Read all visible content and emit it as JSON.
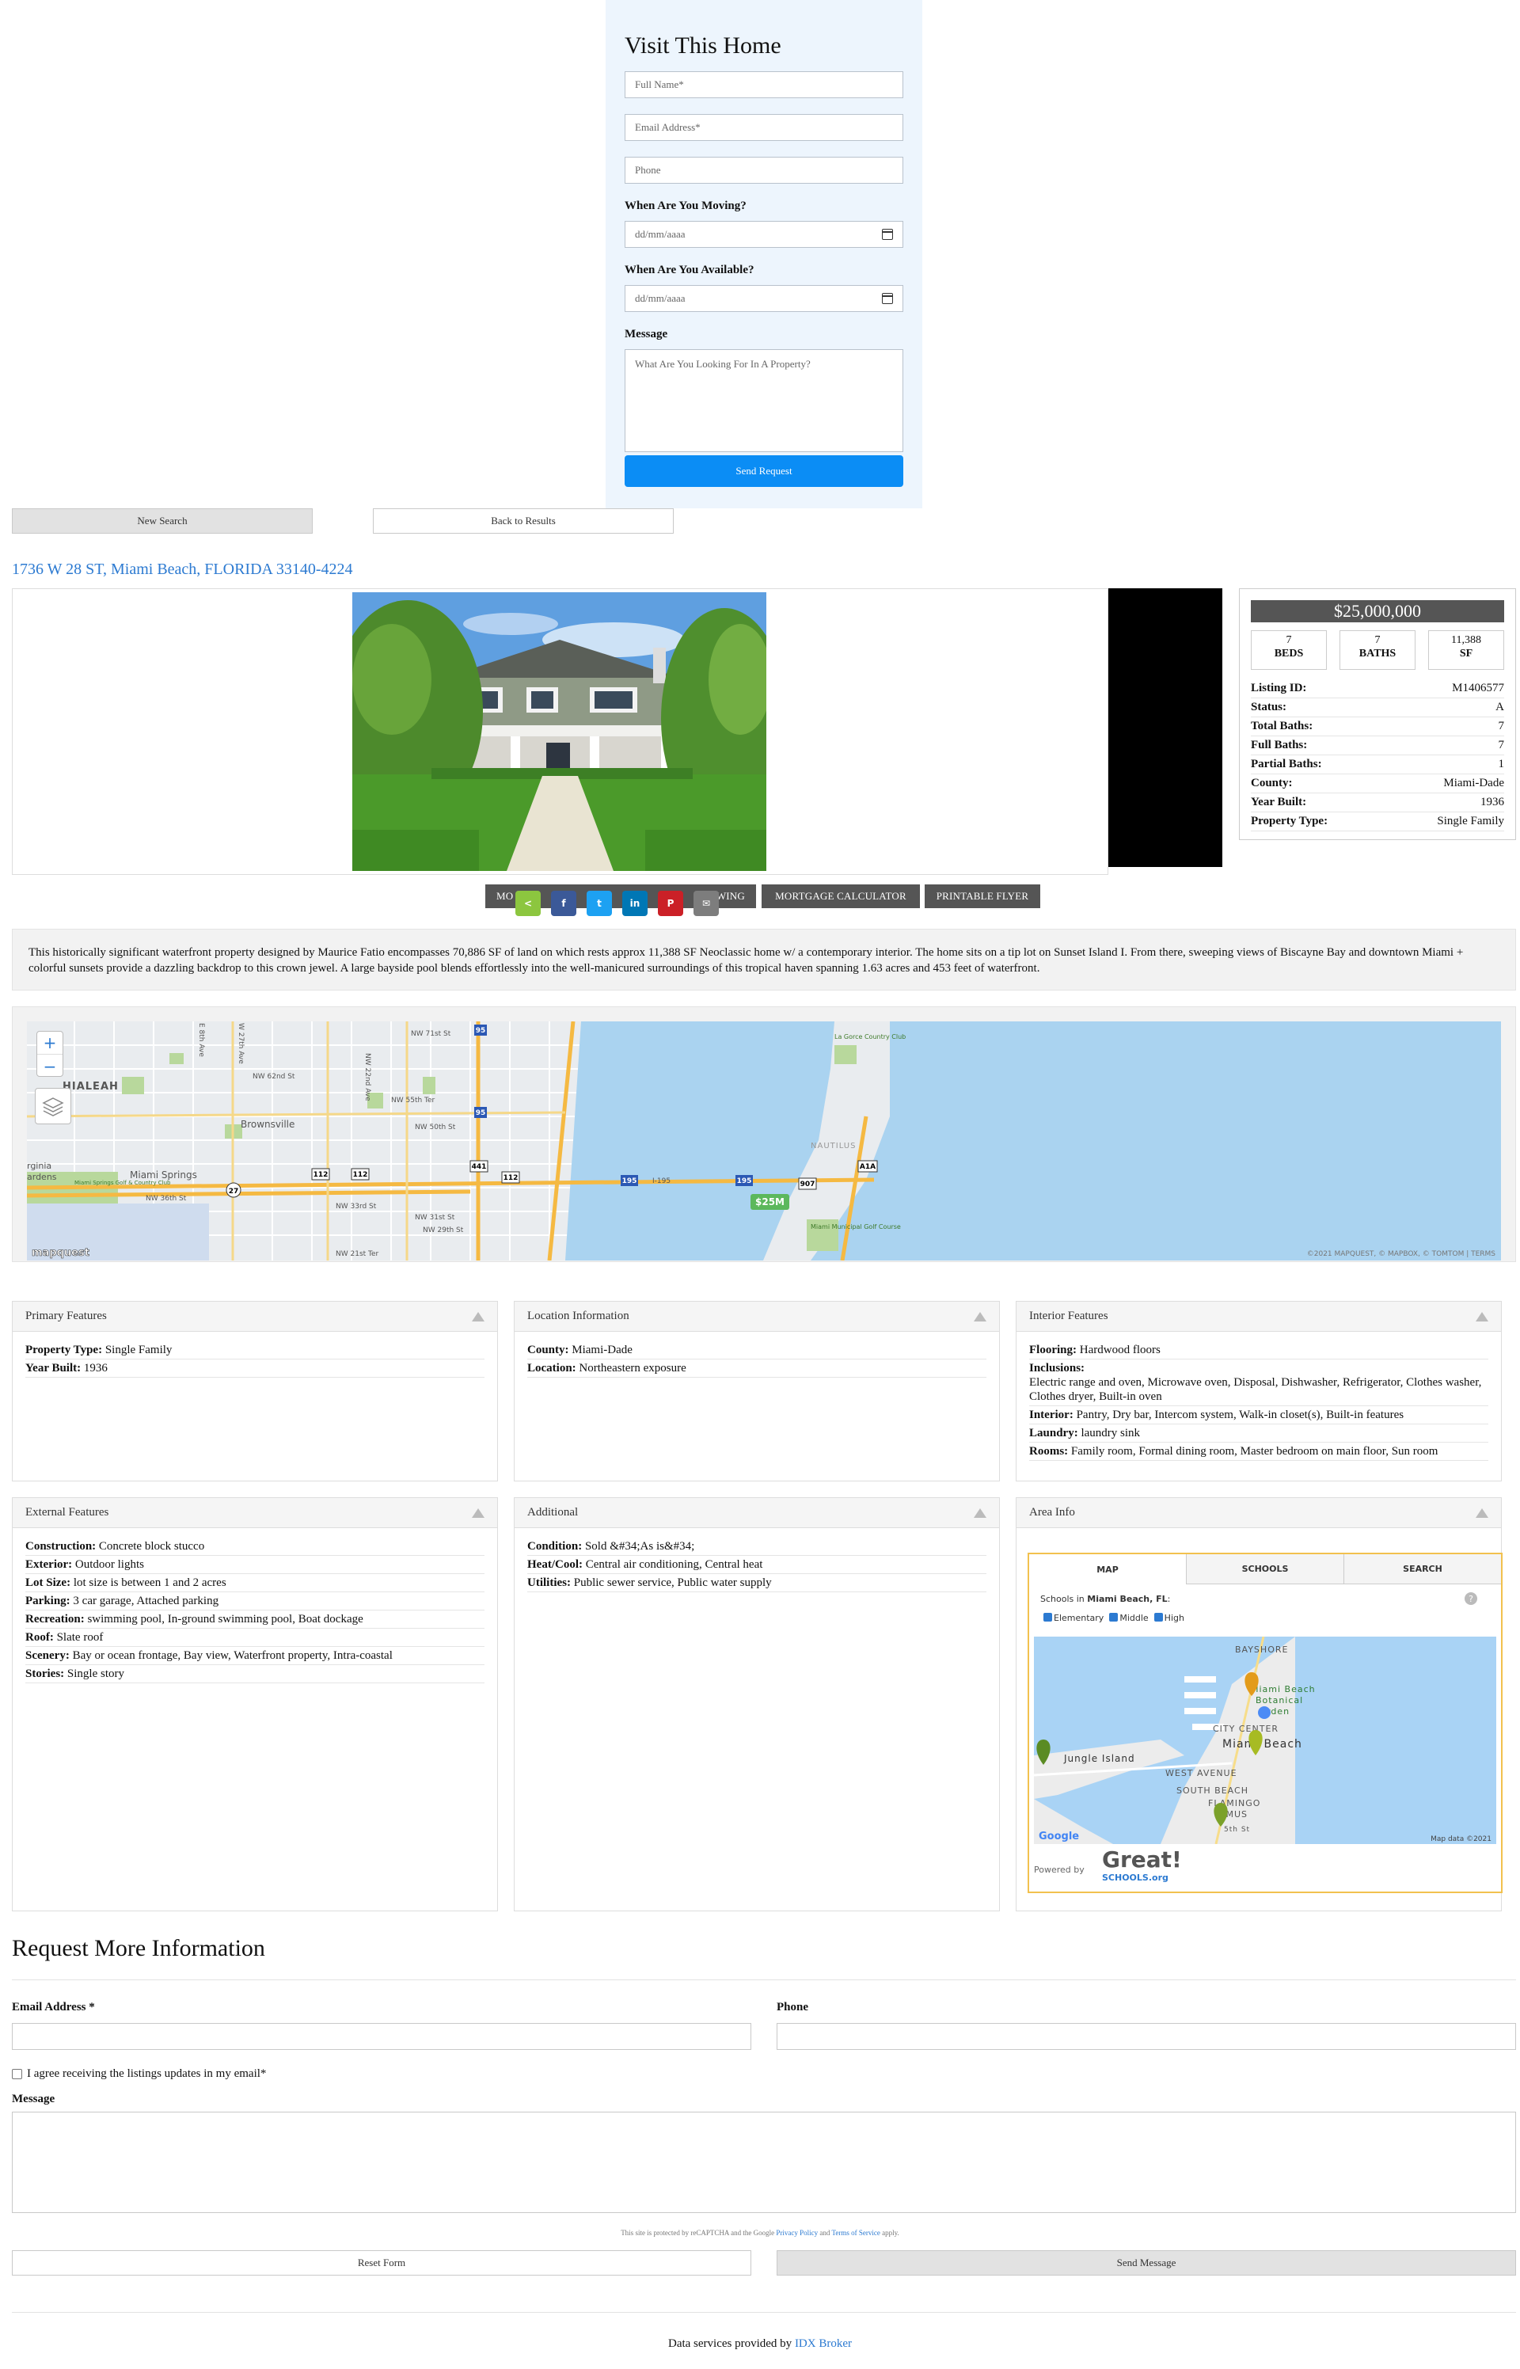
{
  "visit": {
    "title": "Visit This Home",
    "name_placeholder": "Full Name*",
    "email_placeholder": "Email Address*",
    "phone_placeholder": "Phone",
    "moving_label": "When Are You Moving?",
    "moving_date": "dd/mm/aaaa",
    "available_label": "When Are You Available?",
    "available_date": "dd/mm/aaaa",
    "message_label": "Message",
    "message_placeholder": "What Are You Looking For In A Property?",
    "send_label": "Send Request"
  },
  "nav": {
    "new_search": "New Search",
    "back": "Back to Results"
  },
  "address": "1736 W 28 ST, Miami Beach, FLORIDA 33140-4224",
  "listing": {
    "price": "$25,000,000",
    "beds": "7",
    "beds_label": "BEDS",
    "baths": "7",
    "baths_label": "BATHS",
    "sf": "11,388",
    "sf_label": "SF",
    "details": [
      {
        "k": "Listing ID:",
        "v": "M1406577"
      },
      {
        "k": "Status:",
        "v": "A"
      },
      {
        "k": "Total Baths:",
        "v": "7"
      },
      {
        "k": "Full Baths:",
        "v": "7"
      },
      {
        "k": "Partial Baths:",
        "v": "1"
      },
      {
        "k": "County:",
        "v": "Miami-Dade"
      },
      {
        "k": "Year Built:",
        "v": "1936"
      },
      {
        "k": "Property Type:",
        "v": "Single Family"
      }
    ]
  },
  "actions": {
    "schedule_a": "MO",
    "schedule_b": "WING",
    "mortgage": "MORTGAGE CALCULATOR",
    "flyer": "PRINTABLE FLYER"
  },
  "share_icons": {
    "share": "<",
    "facebook": "f",
    "twitter": "t",
    "linkedin": "in",
    "pinterest": "P",
    "email": "✉"
  },
  "description": "This historically significant waterfront property designed by Maurice Fatio encompasses 70,886 SF of land on which rests approx 11,388 SF Neoclassic home w/ a contemporary interior. The home sits on a tip lot on Sunset Island I. From there, sweeping views of Biscayne Bay and downtown Miami + colorful sunsets provide a dazzling backdrop to this crown jewel. A large bayside pool blends effortlessly into the well-manicured surroundings of this tropical haven spanning 1.63 acres and 453 feet of waterfront.",
  "map": {
    "zoom_in": "+",
    "zoom_out": "−",
    "pin_label": "$25M",
    "credit": "©2021 MAPQUEST, © MAPBOX, © TOMTOM | TERMS",
    "logo": "mapquest",
    "labels": {
      "hialeah": "HIALEAH",
      "brownsville": "Brownsville",
      "miami_springs": "Miami Springs",
      "springs_golf": "Miami Springs Golf & Country Club",
      "virginia": "rginia",
      "gardens": "ardens",
      "nw71": "NW 71st St",
      "nw62": "NW 62nd St",
      "nw55": "NW 55th Ter",
      "nw50": "NW 50th St",
      "nw36": "NW 36th St",
      "nw33": "NW 33rd St",
      "nw31": "NW 31st St",
      "nw29": "NW 29th St",
      "nw21": "NW 21st Ter",
      "e8": "E 8th Ave",
      "w27": "W 27th Ave",
      "nw22": "NW 22nd Ave",
      "i195": "I-195",
      "lagorce": "La Gorce Country Club",
      "nautilus": "NAUTILUS",
      "municipal": "Miami Municipal Golf Course",
      "r95a": "95",
      "r95b": "95",
      "r441": "441",
      "r112a": "112",
      "r112b": "112",
      "r112c": "112",
      "r27": "27",
      "r195a": "195",
      "r195b": "195",
      "r907": "907",
      "ra1a": "A1A"
    }
  },
  "panels": {
    "primary": {
      "title": "Primary Features",
      "rows": [
        {
          "k": "Property Type:",
          "v": "Single Family"
        },
        {
          "k": "Year Built:",
          "v": "1936"
        }
      ]
    },
    "location": {
      "title": "Location Information",
      "rows": [
        {
          "k": "County:",
          "v": "Miami-Dade"
        },
        {
          "k": "Location:",
          "v": "Northeastern exposure"
        }
      ]
    },
    "interior": {
      "title": "Interior Features",
      "rows": [
        {
          "k": "Flooring:",
          "v": "Hardwood floors"
        },
        {
          "k": "Inclusions:",
          "v": "Electric range and oven, Microwave oven, Disposal, Dishwasher, Refrigerator, Clothes washer, Clothes dryer, Built-in oven"
        },
        {
          "k": "Interior:",
          "v": "Pantry, Dry bar, Intercom system, Walk-in closet(s), Built-in features"
        },
        {
          "k": "Laundry:",
          "v": "laundry sink"
        },
        {
          "k": "Rooms:",
          "v": "Family room, Formal dining room, Master bedroom on main floor, Sun room"
        }
      ]
    },
    "external": {
      "title": "External Features",
      "rows": [
        {
          "k": "Construction:",
          "v": "Concrete block stucco"
        },
        {
          "k": "Exterior:",
          "v": "Outdoor lights"
        },
        {
          "k": "Lot Size:",
          "v": "lot size is between 1 and 2 acres"
        },
        {
          "k": "Parking:",
          "v": "3 car garage, Attached parking"
        },
        {
          "k": "Recreation:",
          "v": "swimming pool, In-ground swimming pool, Boat dockage"
        },
        {
          "k": "Roof:",
          "v": "Slate roof"
        },
        {
          "k": "Scenery:",
          "v": "Bay or ocean frontage, Bay view, Waterfront property, Intra-coastal"
        },
        {
          "k": "Stories:",
          "v": "Single story"
        }
      ]
    },
    "additional": {
      "title": "Additional",
      "rows": [
        {
          "k": "Condition:",
          "v": "Sold &#34;As is&#34;"
        },
        {
          "k": "Heat/Cool:",
          "v": "Central air conditioning, Central heat"
        },
        {
          "k": "Utilities:",
          "v": "Public sewer service, Public water supply"
        }
      ]
    },
    "area": {
      "title": "Area Info"
    }
  },
  "schools": {
    "tabs": [
      "MAP",
      "SCHOOLS",
      "SEARCH"
    ],
    "caption_prefix": "Schools in ",
    "caption_city": "Miami Beach, FL",
    "caption_suffix": ":",
    "filters": [
      "Elementary",
      "Middle",
      "High"
    ],
    "help": "?",
    "map_labels": {
      "bayshore": "BAYSHORE",
      "botanical1": "Miami Beach",
      "botanical2": "Botanical",
      "botanical3": "rden",
      "citycenter": "CITY CENTER",
      "miami_beach": "Miami Beach",
      "jungle": "Jungle Island",
      "west_avenue": "WEST AVENUE",
      "south_beach": "SOUTH BEACH",
      "flamingo": "FLAMINGO",
      "mmus": "MMUS",
      "sth": "5th St"
    },
    "google": "Google",
    "map_data": "Map data ©2021",
    "powered": "Powered by",
    "great": "Great!",
    "schools_org": "SCHOOLS.org"
  },
  "request": {
    "title": "Request More Information",
    "email_label": "Email Address *",
    "phone_label": "Phone",
    "agree": "I agree receiving the listings updates in my email*",
    "message_label": "Message",
    "recaptcha_a": "This site is protected by reCAPTCHA and the Google ",
    "privacy": "Privacy Policy",
    "recaptcha_and": " and ",
    "terms": "Terms of Service",
    "recaptcha_b": " apply.",
    "reset": "Reset Form",
    "send": "Send Message"
  },
  "footer": {
    "prefix": "Data services provided by ",
    "link": "IDX Broker"
  }
}
